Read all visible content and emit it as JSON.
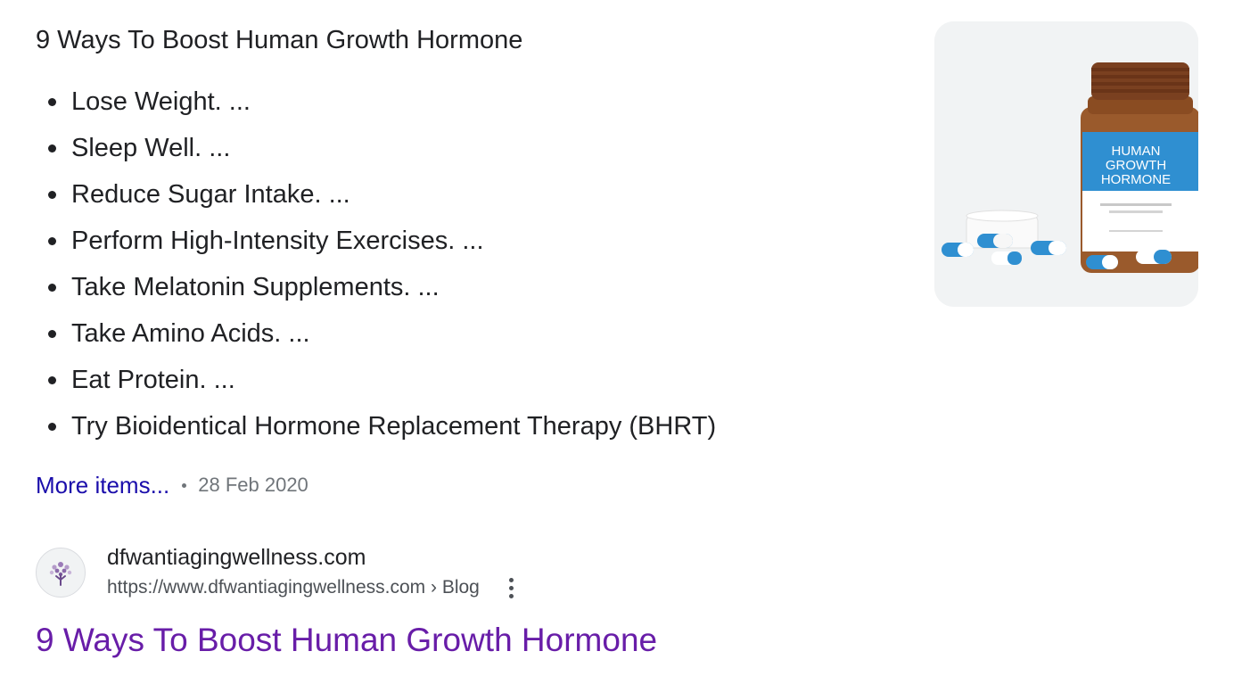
{
  "snippet": {
    "heading": "9 Ways To Boost Human Growth Hormone",
    "items": [
      "Lose Weight. ...",
      "Sleep Well. ...",
      "Reduce Sugar Intake. ...",
      "Perform High-Intensity Exercises. ...",
      "Take Melatonin Supplements. ...",
      "Take Amino Acids. ...",
      "Eat Protein. ...",
      "Try Bioidentical Hormone Replacement Therapy (BHRT)"
    ],
    "more_items_label": "More items...",
    "date": "28 Feb 2020"
  },
  "thumbnail": {
    "icon": "hgh-bottle-image",
    "label_lines": [
      "HUMAN",
      "GROWTH",
      "HORMONE"
    ]
  },
  "result": {
    "favicon_icon": "tree-logo-icon",
    "site_name": "dfwantiagingwellness.com",
    "url": "https://www.dfwantiagingwellness.com › Blog",
    "title": "9 Ways To Boost Human Growth Hormone",
    "menu_icon": "more-vert-icon"
  },
  "colors": {
    "link": "#1a0dab",
    "visited_link": "#681da8",
    "text": "#202124",
    "meta": "#70757a"
  }
}
